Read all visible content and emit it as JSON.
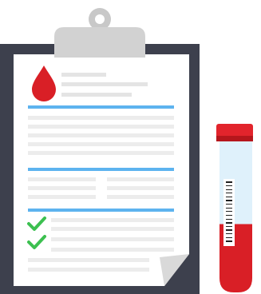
{
  "illustration": {
    "subject": "blood-test-report-clipboard",
    "icons": [
      "blood-drop-icon",
      "check-icon",
      "check-icon",
      "barcode-icon"
    ]
  },
  "report": {
    "section_count": 3,
    "checked_items": 2
  },
  "test_tube": {
    "fill_level": 0.45
  },
  "colors": {
    "board": "#3d404d",
    "paper": "#ffffff",
    "clip": "#cfcfcf",
    "text_line": "#ececec",
    "divider": "#5db3ef",
    "blood": "#d91f26",
    "check": "#3cc050",
    "tube_glass": "#dff1fb",
    "cap": "#e2242c"
  }
}
